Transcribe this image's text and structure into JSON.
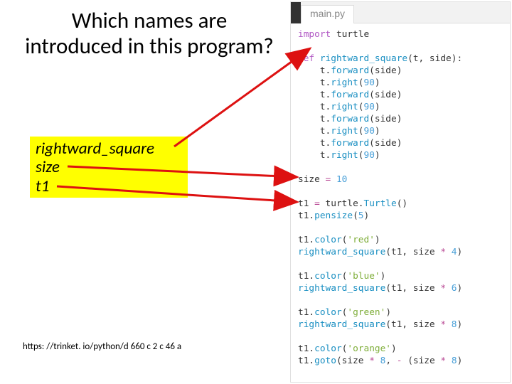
{
  "title": "Which names are introduced in this program?",
  "names": {
    "n1": "rightward_square",
    "n2": "size",
    "n3": "t1"
  },
  "url": "https: //trinket. io/python/d 660 c 2 c 46 a",
  "editor": {
    "tab": "main.py"
  },
  "code": {
    "l01a": "import",
    "l01b": " turtle",
    "l02a": "def ",
    "l02b": "rightward_square",
    "l02c": "(t, side):",
    "l03a": "    t.",
    "l03b": "forward",
    "l03c": "(side)",
    "l04a": "    t.",
    "l04b": "right",
    "l04c": "(",
    "l04d": "90",
    "l04e": ")",
    "l05a": "size ",
    "l05b": "=",
    "l05c": " ",
    "l05d": "10",
    "l06a": "t1 ",
    "l06b": "=",
    "l06c": " turtle.",
    "l06d": "Turtle",
    "l06e": "()",
    "l07a": "t1.",
    "l07b": "pensize",
    "l07c": "(",
    "l07d": "5",
    "l07e": ")",
    "l08a": "t1.",
    "l08b": "color",
    "l08c": "(",
    "l08d": "'red'",
    "l08e": ")",
    "l09a": "rightward_square",
    "l09b": "(t1, size ",
    "l09c": "*",
    "l09d": " ",
    "l09e": "4",
    "l09f": ")",
    "l10d": "'blue'",
    "l11e": "6",
    "l12d": "'green'",
    "l13e": "8",
    "l14d": "'orange'",
    "l15a": "t1.",
    "l15b": "goto",
    "l15c": "(size ",
    "l15d": "*",
    "l15e": " ",
    "l15f": "8",
    "l15g": ", ",
    "l15h": "-",
    "l15i": " (size ",
    "l15j": "*",
    "l15k": " ",
    "l15l": "8",
    "l15m": ")"
  }
}
